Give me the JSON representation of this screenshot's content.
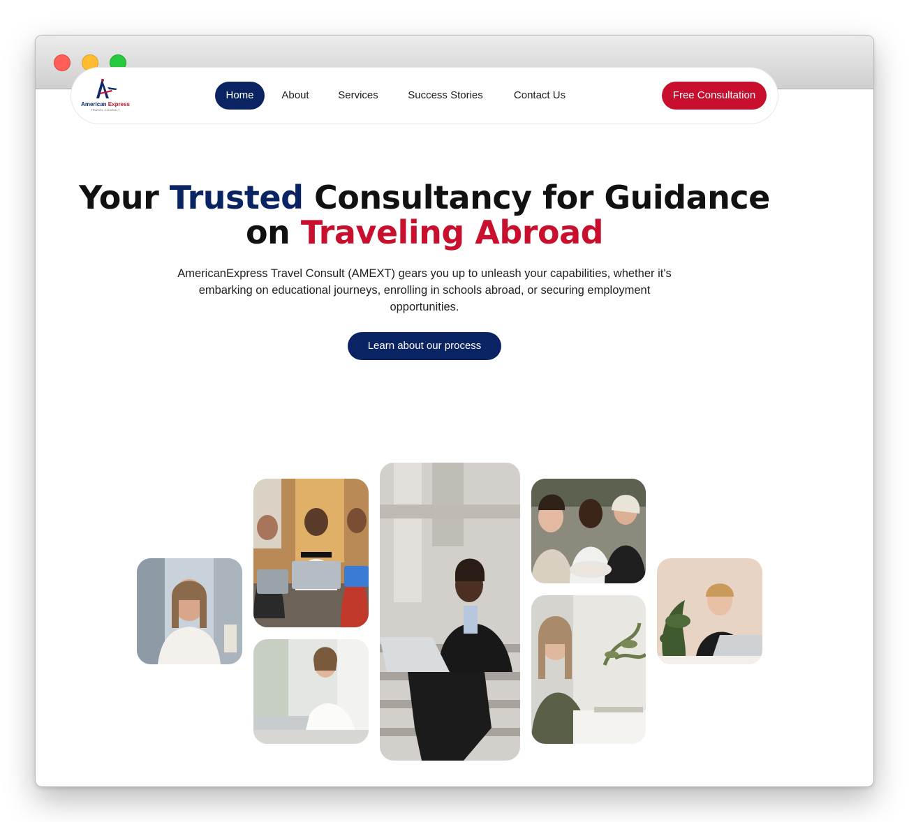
{
  "window": {
    "controls": [
      "close",
      "minimize",
      "maximize"
    ]
  },
  "logo": {
    "text_primary": "American",
    "text_secondary": "Express",
    "tagline": "TRAVEL CONSULT"
  },
  "nav": {
    "items": [
      {
        "label": "Home",
        "active": true
      },
      {
        "label": "About"
      },
      {
        "label": "Services"
      },
      {
        "label": "Success Stories"
      },
      {
        "label": "Contact Us"
      }
    ],
    "cta_label": "Free Consultation"
  },
  "hero": {
    "title_part1": "Your ",
    "title_highlight1": "Trusted",
    "title_part2": " Consultancy for Guidance on ",
    "title_highlight2": "Traveling Abroad",
    "description": "AmericanExpress Travel Consult (AMEXT) gears you up to unleash your capabilities, whether it's embarking on educational journeys, enrolling in schools abroad, or securing employment opportunities.",
    "button_label": "Learn about our process"
  },
  "colors": {
    "brand_blue": "#0a2463",
    "brand_red": "#c8102e"
  },
  "gallery": {
    "photos": [
      "woman-on-phone-photo",
      "students-with-laptops-photo",
      "woman-laughing-at-laptop-photo",
      "man-on-steps-with-laptop-photo",
      "women-looking-at-phone-photo",
      "woman-writing-notes-photo",
      "woman-smiling-at-laptop-photo"
    ]
  }
}
